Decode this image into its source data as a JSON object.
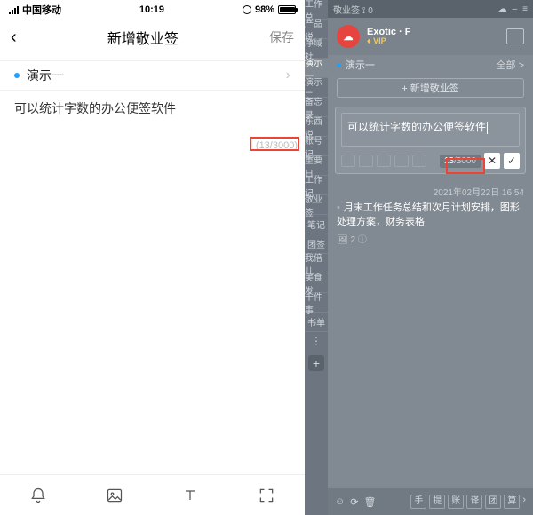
{
  "mobile": {
    "status": {
      "carrier": "中国移动",
      "time": "10:19",
      "battery": "98%"
    },
    "nav": {
      "title": "新增敬业签",
      "save": "保存"
    },
    "category": {
      "label": "演示一"
    },
    "editor_text": "可以统计字数的办公便签软件",
    "char_count": "(13/3000)"
  },
  "desktop": {
    "titlebar": {
      "title": "敬业签",
      "badge": "0"
    },
    "user": {
      "name": "Exotic · F",
      "vip": "VIP"
    },
    "category": {
      "label": "演示一",
      "all": "全部 >"
    },
    "add_button": "+ 新增敬业签",
    "edit": {
      "text": "可以统计字数的办公便签软件",
      "count_current": "13",
      "count_total": "/3000"
    },
    "note": {
      "time": "2021年02月22日 16:54",
      "body": "月末工作任务总结和次月计划安排，图形处理方案，财务表格",
      "meta": "🖼 2 ⓘ"
    },
    "side_tabs": [
      "工作总",
      "产品说",
      "净域社",
      "演示一",
      "演示二",
      "备忘录",
      "东西说",
      "账号记",
      "重要日",
      "工作记",
      "敬业签",
      "笔记",
      "团签",
      "我倍儿",
      "美食发",
      "十件事",
      "书单"
    ],
    "bottom_chips": [
      "手",
      "提",
      "账",
      "译",
      "团",
      "算"
    ]
  }
}
